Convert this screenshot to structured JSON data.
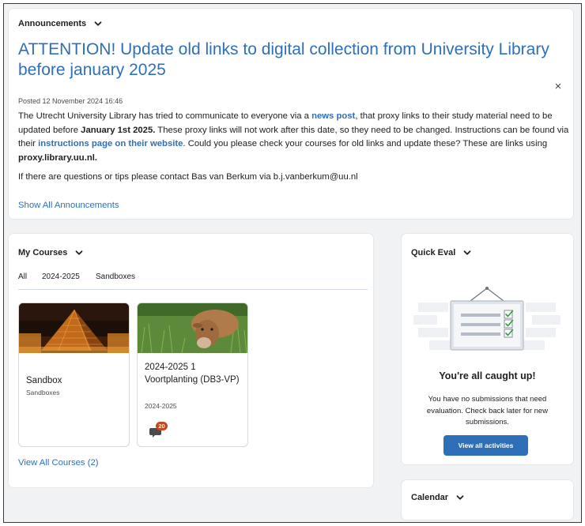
{
  "announcements": {
    "header": "Announcements",
    "title": "ATTENTION! Update old links to digital collection from University Library before january 2025",
    "posted": "Posted 12 November 2024 16:46",
    "close_glyph": "×",
    "body_1": "The Utrecht University Library has tried to communicate to everyone via a ",
    "link_news": "news post",
    "body_2": ", that proxy links to their study material need to be updated before ",
    "bold_date": "January 1st 2025.",
    "body_3": " These proxy links will not work after this date, so they need to be changed. Instructions can be found via their ",
    "link_instructions": "instructions page on their website",
    "body_4": ". Could you please check your courses for old links and update these? These are links using ",
    "bold_proxy": "proxy.library.uu.nl.",
    "contact": "If there are questions or tips please contact Bas van Berkum via b.j.vanberkum@uu.nl",
    "show_all": "Show All Announcements"
  },
  "courses": {
    "header": "My Courses",
    "tabs": [
      "All",
      "2024-2025",
      "Sandboxes"
    ],
    "cards": [
      {
        "title": "Sandbox",
        "subtitle": "Sandboxes"
      },
      {
        "title": "2024-2025 1 Voortplanting (DB3-VP)",
        "subtitle": "2024-2025",
        "notification_count": "20"
      }
    ],
    "view_all": "View All Courses (2)"
  },
  "quick_eval": {
    "header": "Quick Eval",
    "title": "You're all caught up!",
    "text": "You have no submissions that need evaluation. Check back later for new submissions.",
    "button": "View all activities"
  },
  "calendar": {
    "header": "Calendar"
  },
  "icons": {
    "chevron": "chevron-down-icon",
    "close": "close-icon",
    "notification": "chat-notification-icon"
  },
  "colors": {
    "link": "#2f6fb8",
    "badge": "#c5481d",
    "background": "#f1f2f4"
  }
}
